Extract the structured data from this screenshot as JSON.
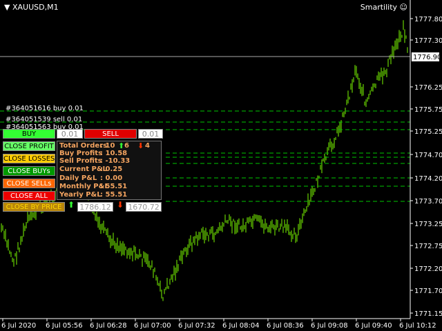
{
  "chart": {
    "symbol": "XAUUSD,M1",
    "brand": "Smartility",
    "current_price": "1776.90",
    "y_ticks": [
      "1777.80",
      "1777.30",
      "1776.25",
      "1775.75",
      "1775.25",
      "1774.70",
      "1774.20",
      "1773.70",
      "1773.25",
      "1772.75",
      "1772.20",
      "1771.70",
      "1771.15"
    ],
    "x_ticks": [
      "6 Jul 2020",
      "6 Jul 05:56",
      "6 Jul 06:28",
      "6 Jul 07:00",
      "6 Jul 07:32",
      "6 Jul 08:04",
      "6 Jul 08:36",
      "6 Jul 09:08",
      "6 Jul 09:40",
      "6 Jul 10:12"
    ],
    "colors": {
      "bars": "#7CFC00",
      "grid_lines": "#00c800",
      "axis": "#ffffff"
    }
  },
  "tickets": [
    "#364051616 buy 0.01",
    "#364051539 sell 0.01",
    "#364051563 buy 0.01"
  ],
  "panel": {
    "buy_label": "BUY",
    "sell_label": "SELL",
    "buy_lot": "0.01",
    "sell_lot": "0.01",
    "close_profit": "CLOSE PROFIT",
    "close_losses": "CLOSE LOSSES",
    "close_buys": "CLOSE BUYs",
    "close_sells": "CLOSE SELLs",
    "close_all": "CLOSE ALL",
    "close_by_price": "CLOSE BY PRICE",
    "price_up_value": "1786.12",
    "price_down_value": "1670.72"
  },
  "info": {
    "total_orders_label": "Total Orders",
    "total_orders_value": ": 10",
    "up_count": "6",
    "down_count": "4",
    "buy_profits_label": "Buy Profits",
    "buy_profits_value": ": 10.58",
    "sell_profits_label": "Sell Profits",
    "sell_profits_value": ": -10.33",
    "current_pl_label": "Current P&L",
    "current_pl_value": ": 0.25",
    "daily_pl_label": "Daily P&L",
    "daily_pl_value": ": 0.00",
    "monthly_pl_label": "Monthly P&L",
    "monthly_pl_value": ": 55.51",
    "yearly_pl_label": "Yearly P&L",
    "yearly_pl_value": ": 55.51"
  }
}
